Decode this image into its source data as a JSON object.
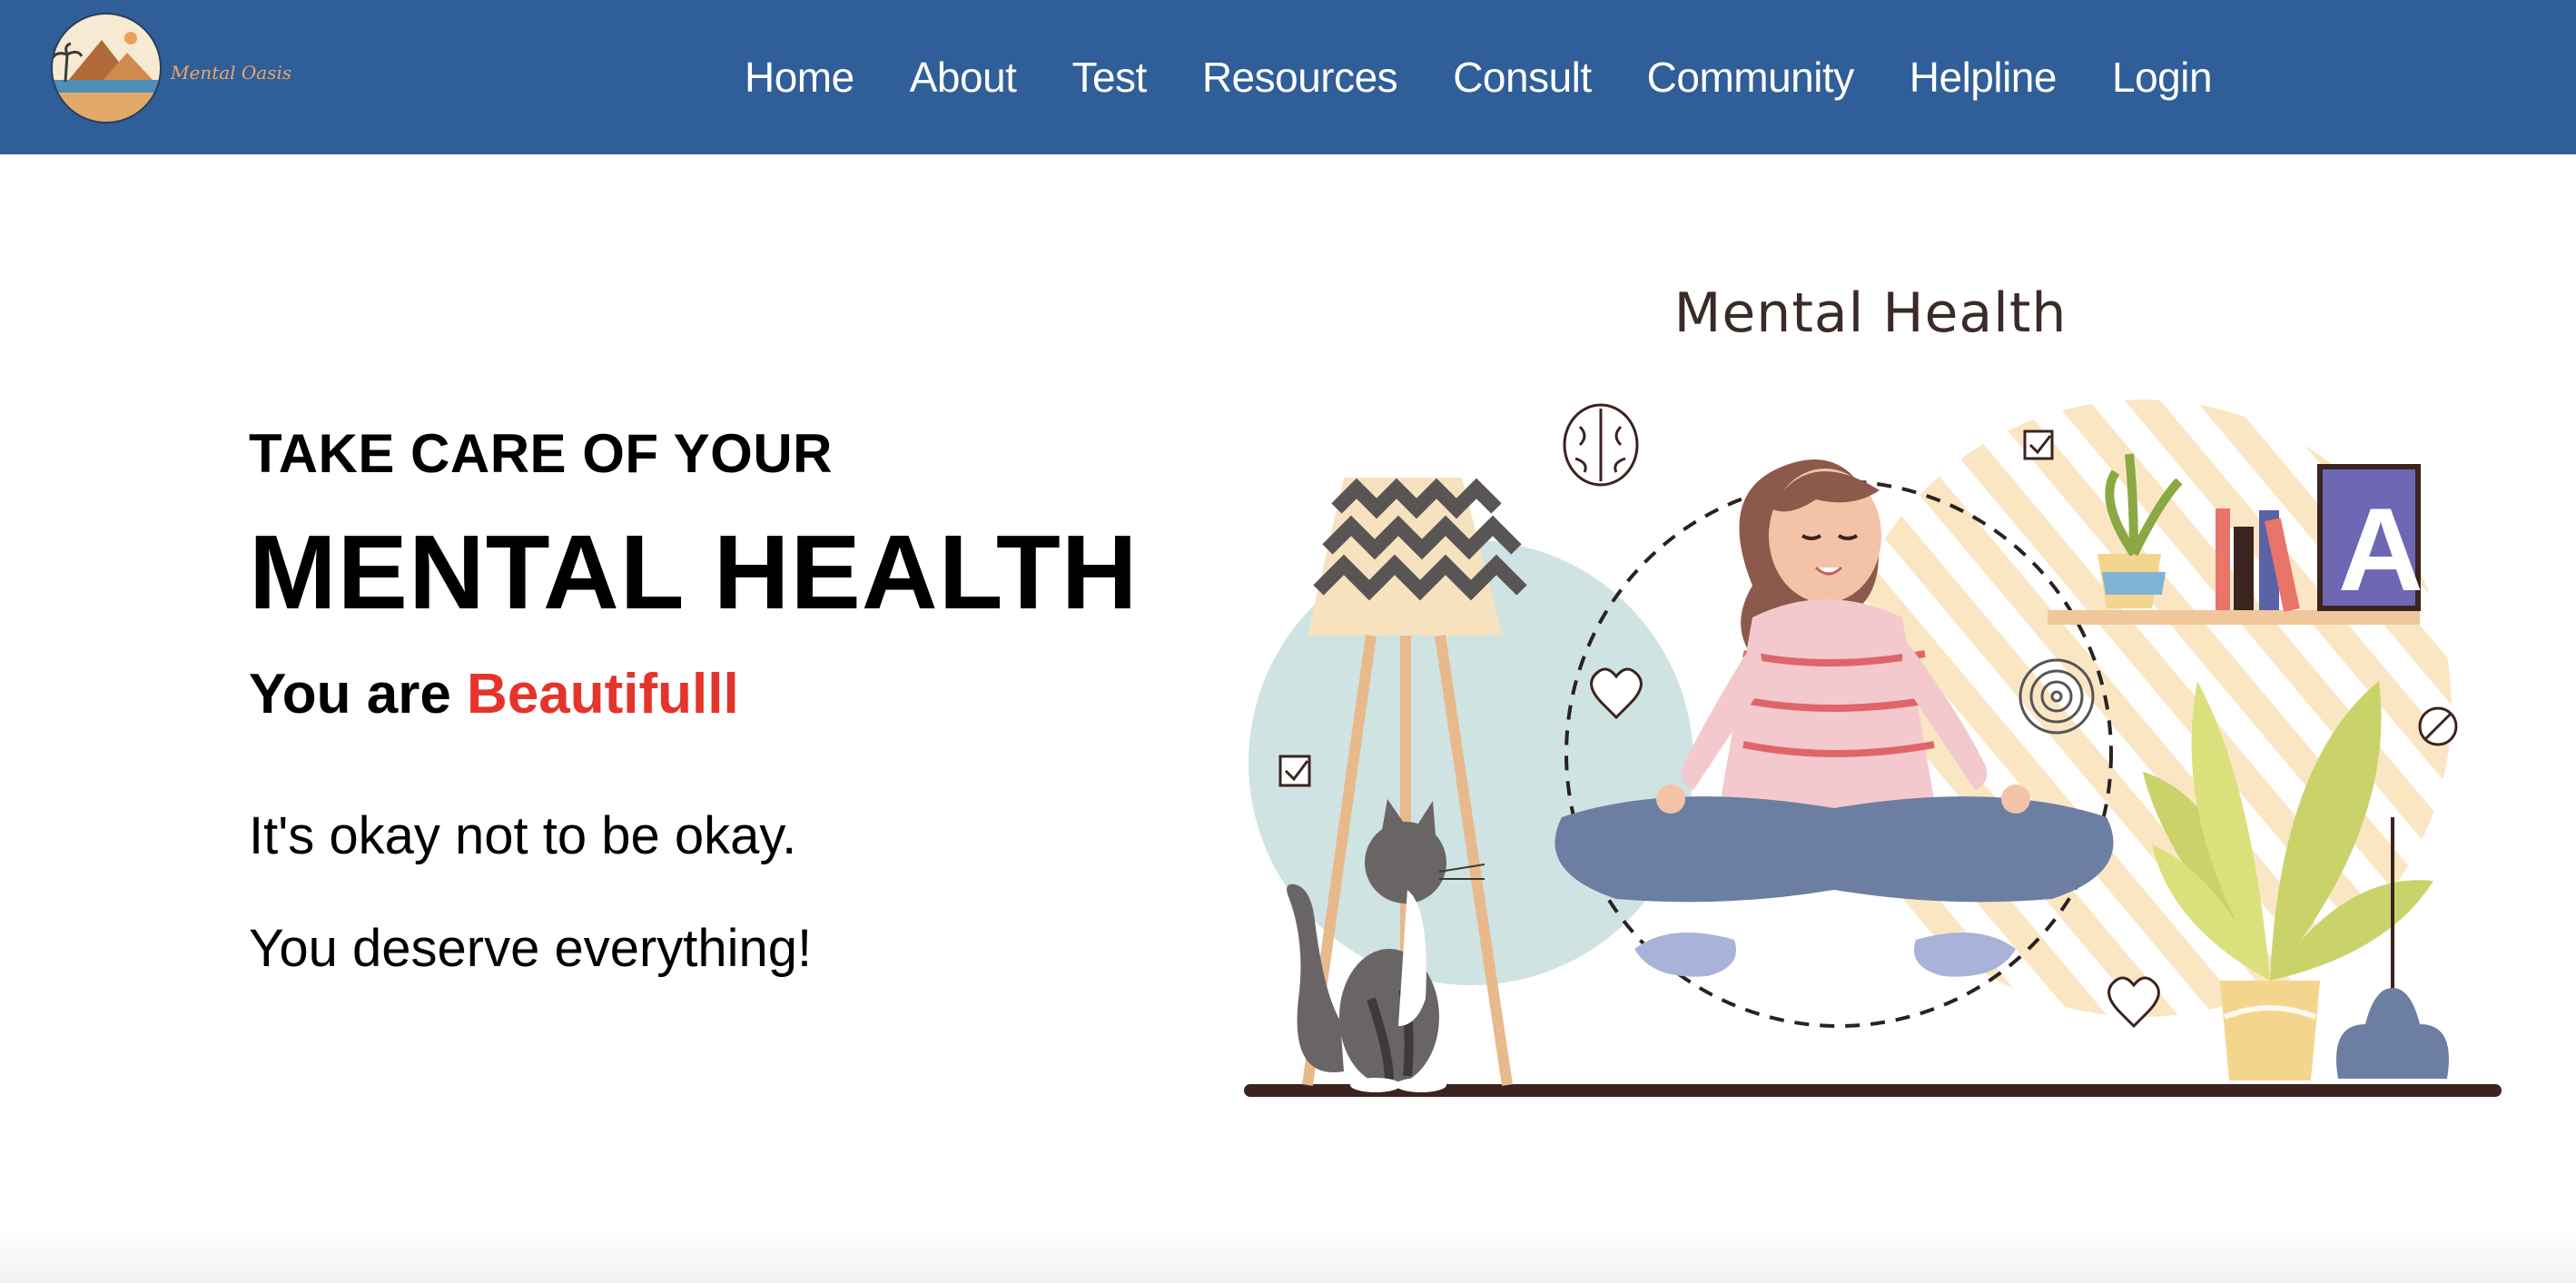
{
  "brand": {
    "name": "Mental Oasis",
    "logo_icon": "desert-oasis-logo-icon"
  },
  "nav": {
    "items": [
      {
        "label": "Home"
      },
      {
        "label": "About"
      },
      {
        "label": "Test"
      },
      {
        "label": "Resources"
      },
      {
        "label": "Consult"
      },
      {
        "label": "Community"
      },
      {
        "label": "Helpline"
      },
      {
        "label": "Login"
      }
    ]
  },
  "hero": {
    "eyebrow": "TAKE CARE OF YOUR",
    "headline": "MENTAL HEALTH",
    "tagline_prefix": "You are",
    "tagline_accent": "Beautifulll",
    "line1": "It's okay not to be okay.",
    "line2": "You deserve everything!"
  },
  "illustration": {
    "title": "Mental Health",
    "book_letter": "A",
    "icons": [
      "brain-icon",
      "heart-icon",
      "checkbox-icon",
      "spiral-icon",
      "no-entry-icon"
    ]
  },
  "colors": {
    "nav_bg": "#2f5e98",
    "accent": "#e5342b",
    "text": "#000000"
  }
}
